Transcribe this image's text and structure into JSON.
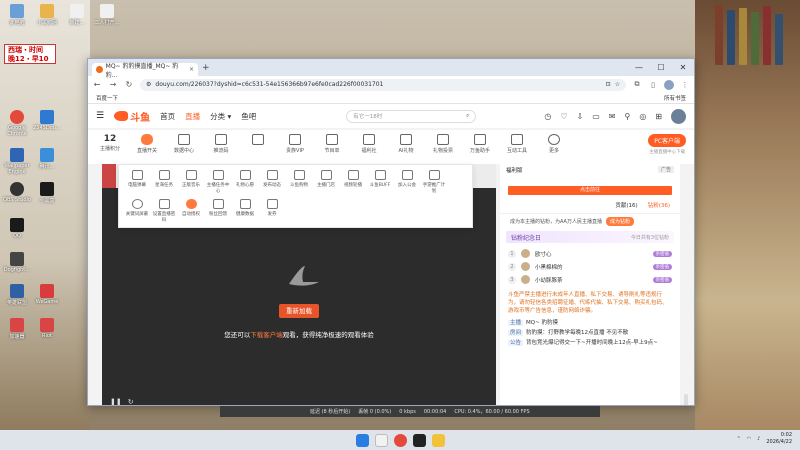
{
  "desktop": {
    "sticker": "西瑞・时间\n晚12・早10",
    "icons": [
      {
        "label": "此电脑",
        "color": "#6a9fd8"
      },
      {
        "label": "小黑鹅网",
        "color": "#e9b44c"
      },
      {
        "label": "新建…",
        "color": "#f0f0f0"
      },
      {
        "label": "二人打开…",
        "color": "#f0f0f0"
      },
      {
        "label": "Google Chrome",
        "color": "#e34a3b"
      },
      {
        "label": "2345Dou…",
        "color": "#2e7ad1"
      },
      {
        "label": "Wallpaper Engine",
        "color": "#2f65b5"
      },
      {
        "label": "腾讯…",
        "color": "#3a8fd8"
      },
      {
        "label": "OBS Studio",
        "color": "#333"
      },
      {
        "label": "小黑盒",
        "color": "#1b1b1b"
      },
      {
        "label": "QQ",
        "color": "#1a1a1a"
      },
      {
        "label": "Dogfight…",
        "color": "#444"
      },
      {
        "label": "英雄联盟",
        "color": "#2f5fa5"
      },
      {
        "label": "WeGame",
        "color": "#d93c3c"
      },
      {
        "label": "加速器",
        "color": "#d94444"
      },
      {
        "label": "Riot",
        "color": "#d94444"
      }
    ]
  },
  "browser": {
    "tab_title": "MQ~ 豹豹摸直播_MQ~ 豹豹…",
    "tab_close": "×",
    "new_tab": "+",
    "win_min": "—",
    "win_max": "☐",
    "win_close": "✕",
    "url": "douyu.com/226037?dyshid=c6c531-54e156366b97e6fe0cad226f00031701",
    "bookmark": "百度一下",
    "bookmarks_right": "所有书签"
  },
  "site": {
    "logo": "斗鱼",
    "nav": [
      "首页",
      "直播",
      "分类 ▾",
      "鱼吧"
    ],
    "search_placeholder": "有它一18时",
    "shortcuts": [
      {
        "label": "主播积分",
        "num": "12"
      },
      {
        "label": "直播开关"
      },
      {
        "label": "数据中心"
      },
      {
        "label": "推流码"
      },
      {
        "label": ""
      },
      {
        "label": "贵族VIP"
      },
      {
        "label": "节目单"
      },
      {
        "label": "福利社"
      },
      {
        "label": "AI礼物"
      },
      {
        "label": "礼物投票"
      },
      {
        "label": "万鱼助手"
      },
      {
        "label": "互动工具"
      },
      {
        "label": "更多"
      }
    ],
    "pc_client": "PC客户端",
    "pc_client_sub": "主播直播中心下载",
    "dropdown": [
      "电脑弹幕",
      "星海任务",
      "正版音乐",
      "主播任务中心",
      "礼物心愿",
      "发布动态",
      "斗鱼购物",
      "主播门店",
      "视频轮播",
      "斗鱼BUFF",
      "加入公会",
      "手游推广计划",
      "关键词屏蔽",
      "设置直播密码",
      "自动授权",
      "粉丝回馈",
      "健康数据",
      "发券"
    ],
    "reload_button": "重新加载",
    "client_text_pre": "您还可以",
    "client_text_link": "下载客户端",
    "client_text_post": "观看，获得纯净极速的观看体验",
    "side": {
      "banner": "福利版",
      "ad_tag": "广告",
      "banner_button": "点击前往",
      "tabs": [
        "贡献(16)",
        "钻粉(36)"
      ],
      "fan_text": "成为本主播的钻粉，为AA万人民主播直播",
      "fan_button": "成为钻粉",
      "fan_day": "钻粉纪念日",
      "fan_day_more": "今日共有3位钻粉",
      "fans": [
        {
          "rank": "1",
          "name": "欧寸心",
          "badge": "亲密值"
        },
        {
          "rank": "2",
          "name": "小黑棉棉的",
          "badge": "亲密值"
        },
        {
          "rank": "3",
          "name": "小幼豚豚茶",
          "badge": "亲密值"
        }
      ],
      "notice": "斗鱼严禁主播进行未成年人直播、私下交易、诱导刷礼等违规行为，请勿轻信各类招聘征婚、代练代抽、私下交易、购买礼包码、游戏币等广告信息，谨防网络诈骗。",
      "chats": [
        {
          "lbl": "主播",
          "text": "MQ~ 豹豹摸"
        },
        {
          "lbl": "房间",
          "text": "豹豹摸：打野教学每晚12点直播 不见不散"
        },
        {
          "lbl": "公告",
          "text": "背包竞光爆记得交一下~开播时间晚上12点-早上9点~"
        }
      ]
    },
    "status": {
      "latency": "延迟 (8 秒后开始)",
      "fps": "丢帧 0 (0.0%)",
      "bitrate": "0 kbps",
      "time": "00:00:04",
      "cpu": "CPU: 0.4%，60.00 / 60.00 FPS"
    }
  },
  "taskbar": {
    "time": "0:02",
    "date": "2026/4/22"
  }
}
